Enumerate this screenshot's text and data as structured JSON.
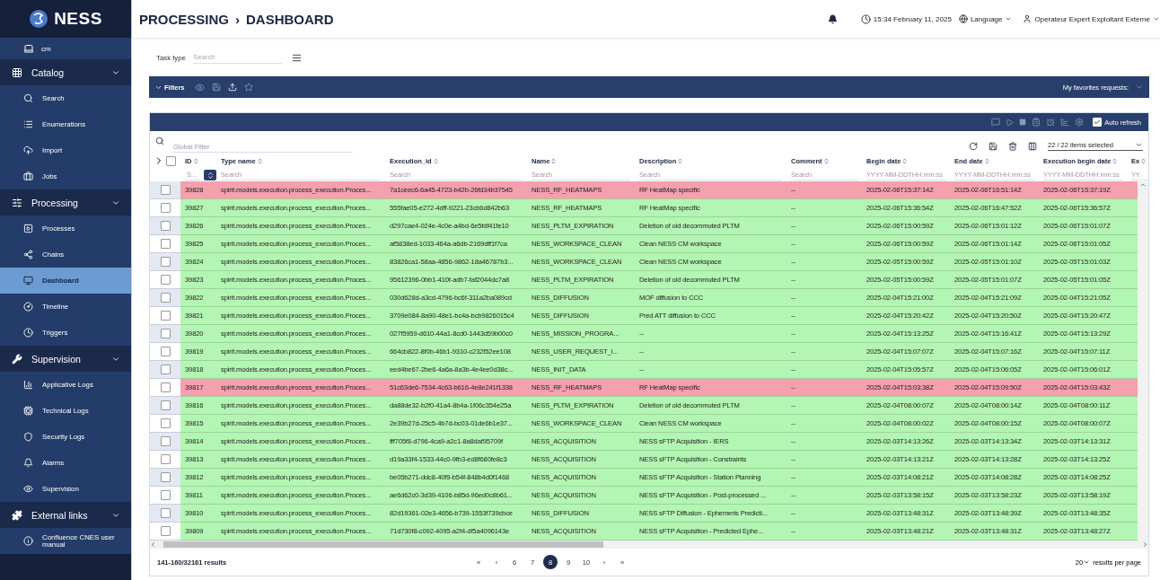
{
  "logo": {
    "text": "NESS"
  },
  "sidebar": {
    "top_item": {
      "label": "cm",
      "selected": false
    },
    "groups": [
      {
        "label": "Catalog",
        "expanded": true,
        "children": [
          {
            "label": "Search",
            "selected": false
          },
          {
            "label": "Enumerations",
            "selected": false
          },
          {
            "label": "Import",
            "selected": false
          },
          {
            "label": "Jobs",
            "selected": false
          }
        ]
      },
      {
        "label": "Processing",
        "expanded": true,
        "children": [
          {
            "label": "Processes",
            "selected": false
          },
          {
            "label": "Chains",
            "selected": false
          },
          {
            "label": "Dashboard",
            "selected": true
          },
          {
            "label": "Timeline",
            "selected": false
          },
          {
            "label": "Triggers",
            "selected": false
          }
        ]
      },
      {
        "label": "Supervision",
        "expanded": true,
        "children": [
          {
            "label": "Applicative Logs",
            "selected": false
          },
          {
            "label": "Technical Logs",
            "selected": false
          },
          {
            "label": "Security Logs",
            "selected": false
          },
          {
            "label": "Alarms",
            "selected": false
          },
          {
            "label": "Supervision",
            "selected": false
          }
        ]
      },
      {
        "label": "External links",
        "expanded": true,
        "children": [
          {
            "label": "Confluence CNES user manual",
            "selected": false
          }
        ]
      }
    ]
  },
  "header": {
    "breadcrumb": [
      "PROCESSING",
      "›",
      "DASHBOARD"
    ],
    "time": "15:34 February 11, 2025",
    "language": "Language",
    "user": "Operateur Expert Exploitant Externe"
  },
  "task_type": {
    "label": "Task type",
    "placeholder": "Search"
  },
  "filters_bar": {
    "label": "Filters",
    "expanded": true,
    "favorites_label": "My favorites requests:"
  },
  "table": {
    "auto_refresh": {
      "label": "Auto refresh",
      "checked": true
    },
    "global_filter": {
      "placeholder": "Global Filter"
    },
    "columns_selected": "22 / 22 items selected",
    "header_checked": false,
    "columns": [
      {
        "label": "ID",
        "placeholder": "S..."
      },
      {
        "label": "Type name",
        "placeholder": "Search"
      },
      {
        "label": "Execution_id",
        "placeholder": "Search"
      },
      {
        "label": "Name",
        "placeholder": "Search"
      },
      {
        "label": "Description",
        "placeholder": "Search"
      },
      {
        "label": "Comment",
        "placeholder": "Search"
      },
      {
        "label": "Begin date",
        "placeholder": "YYYY-MM-DDTHH:mm:ss"
      },
      {
        "label": "End date",
        "placeholder": "YYYY-MM-DDTHH:mm:ss"
      },
      {
        "label": "Execution begin date",
        "placeholder": "YYYY-MM-DDTHH:mm:ss"
      },
      {
        "label": "Ex",
        "placeholder": "YY"
      }
    ],
    "rows": [
      {
        "color": "#f4a0ad",
        "checked": false,
        "cells": [
          "39828",
          "spirit.models.execution.process_execution.Proces...",
          "7a1ceec6-6a45-4723-b42b-26fd34b37545",
          "NESS_RF_HEATMAPS",
          "RF HeatMap specific",
          "--",
          "2025-02-06T15:37:14Z",
          "2025-02-06T16:51:14Z",
          "2025-02-06T15:37:19Z"
        ]
      },
      {
        "color": "#b3f5b3",
        "checked": false,
        "cells": [
          "39827",
          "spirit.models.execution.process_execution.Proces...",
          "555fae05-e272-4dff-9221-23cb6d842b63",
          "NESS_RF_HEATMAPS",
          "RF HeatMap specific",
          "--",
          "2025-02-06T15:36:54Z",
          "2025-02-06T16:47:52Z",
          "2025-02-06T15:36:57Z"
        ]
      },
      {
        "color": "#b3f5b3",
        "checked": false,
        "cells": [
          "39826",
          "spirit.models.execution.process_execution.Proces...",
          "d297cae4-024e-4c0e-a4bd-6e5fdf41fe10",
          "NESS_PLTM_EXPIRATION",
          "Deletion of old decommuted PLTM",
          "--",
          "2025-02-06T15:00:59Z",
          "2025-02-06T15:01:12Z",
          "2025-02-06T15:01:07Z"
        ]
      },
      {
        "color": "#b3f5b3",
        "checked": false,
        "cells": [
          "39825",
          "spirit.models.execution.process_execution.Proces...",
          "af5838ed-1033-464a-a6db-2169dff1f7ca",
          "NESS_WORKSPACE_CLEAN",
          "Clean NESS CM workspace",
          "--",
          "2025-02-06T15:00:59Z",
          "2025-02-06T15:01:14Z",
          "2025-02-06T15:01:05Z"
        ]
      },
      {
        "color": "#b3f5b3",
        "checked": false,
        "cells": [
          "39824",
          "spirit.models.execution.process_execution.Proces...",
          "83826ca1-58aa-4856-9862-18a46787b3...",
          "NESS_WORKSPACE_CLEAN",
          "Clean NESS CM workspace",
          "--",
          "2025-02-05T15:00:59Z",
          "2025-02-05T15:01:10Z",
          "2025-02-05T15:01:03Z"
        ]
      },
      {
        "color": "#b3f5b3",
        "checked": false,
        "cells": [
          "39823",
          "spirit.models.execution.process_execution.Proces...",
          "95612396-0bb1-410f-adb7-faf2044dc7a8",
          "NESS_PLTM_EXPIRATION",
          "Deletion of old decommuted PLTM",
          "--",
          "2025-02-05T15:00:59Z",
          "2025-02-05T15:01:07Z",
          "2025-02-05T15:01:05Z"
        ]
      },
      {
        "color": "#b3f5b3",
        "checked": false,
        "cells": [
          "39822",
          "spirit.models.execution.process_execution.Proces...",
          "030d628d-a3cd-4796-bc6f-311a2ba089cd",
          "NESS_DIFFUSION",
          "MOF diffusion to CCC",
          "--",
          "2025-02-04T15:21:00Z",
          "2025-02-04T15:21:09Z",
          "2025-02-04T15:21:05Z"
        ]
      },
      {
        "color": "#b3f5b3",
        "checked": false,
        "cells": [
          "39821",
          "spirit.models.execution.process_execution.Proces...",
          "3709e084-8a90-48e1-bc4a-bcb9826015c4",
          "NESS_DIFFUSION",
          "Pred ATT diffusion to CCC",
          "--",
          "2025-02-04T15:20:42Z",
          "2025-02-04T15:20:50Z",
          "2025-02-04T15:20:47Z"
        ]
      },
      {
        "color": "#b3f5b3",
        "checked": false,
        "cells": [
          "39820",
          "spirit.models.execution.process_execution.Proces...",
          "027f5959-d610-44a1-8cd0-1443d59b00c0",
          "NESS_MISSION_PROGRA...",
          "--",
          "--",
          "2025-02-04T15:13:25Z",
          "2025-02-04T15:16:41Z",
          "2025-02-04T15:13:29Z"
        ]
      },
      {
        "color": "#b3f5b3",
        "checked": false,
        "cells": [
          "39819",
          "spirit.models.execution.process_execution.Proces...",
          "664cb822-8f0b-46b1-9310-c232f52ee108",
          "NESS_USER_REQUEST_I...",
          "--",
          "--",
          "2025-02-04T15:07:07Z",
          "2025-02-04T15:07:16Z",
          "2025-02-04T15:07:11Z"
        ]
      },
      {
        "color": "#b3f5b3",
        "checked": false,
        "cells": [
          "39818",
          "spirit.models.execution.process_execution.Proces...",
          "eed4be67-2be6-4a6a-8a3b-4e4ee0d38c...",
          "NESS_INIT_DATA",
          "--",
          "--",
          "2025-02-04T15:05:57Z",
          "2025-02-04T15:06:05Z",
          "2025-02-04T15:06:01Z"
        ]
      },
      {
        "color": "#f4a0ad",
        "checked": false,
        "cells": [
          "39817",
          "spirit.models.execution.process_execution.Proces...",
          "51c63de6-7534-4c63-b616-4e8e241f1338",
          "NESS_RF_HEATMAPS",
          "RF HeatMap specific",
          "--",
          "2025-02-04T15:03:38Z",
          "2025-02-04T15:09:50Z",
          "2025-02-04T15:03:43Z"
        ]
      },
      {
        "color": "#b3f5b3",
        "checked": false,
        "cells": [
          "39816",
          "spirit.models.execution.process_execution.Proces...",
          "da88de32-b2f0-41a4-8b4a-1f06c354e25a",
          "NESS_PLTM_EXPIRATION",
          "Deletion of old decommuted PLTM",
          "--",
          "2025-02-04T08:00:07Z",
          "2025-02-04T08:00:14Z",
          "2025-02-04T08:00:11Z"
        ]
      },
      {
        "color": "#b3f5b3",
        "checked": false,
        "cells": [
          "39815",
          "spirit.models.execution.process_execution.Proces...",
          "2e39b27d-25c5-4b7d-bc03-01de6b1e37...",
          "NESS_WORKSPACE_CLEAN",
          "Clean NESS CM workspace",
          "--",
          "2025-02-04T08:00:02Z",
          "2025-02-04T08:00:15Z",
          "2025-02-04T08:00:07Z"
        ]
      },
      {
        "color": "#b3f5b3",
        "checked": false,
        "cells": [
          "39814",
          "spirit.models.execution.process_execution.Proces...",
          "fff705f8-d796-4ca9-a2c1-8a8daf95709f",
          "NESS_ACQUISITION",
          "NESS sFTP Acquisition - IERS",
          "--",
          "2025-02-03T14:13:26Z",
          "2025-02-03T14:13:34Z",
          "2025-02-03T14:13:31Z"
        ]
      },
      {
        "color": "#b3f5b3",
        "checked": false,
        "cells": [
          "39813",
          "spirit.models.execution.process_execution.Proces...",
          "d19a33f4-1533-44c0-9fb3-ed8f680fe8c3",
          "NESS_ACQUISITION",
          "NESS sFTP Acquisition - Constraints",
          "--",
          "2025-02-03T14:13:21Z",
          "2025-02-03T14:13:28Z",
          "2025-02-03T14:13:25Z"
        ]
      },
      {
        "color": "#b3f5b3",
        "checked": false,
        "cells": [
          "39812",
          "spirit.models.execution.process_execution.Proces...",
          "be05b271-ddc8-40f9-b54f-848b4d0f1468",
          "NESS_ACQUISITION",
          "NESS sFTP Acquisition - Station Planning",
          "--",
          "2025-02-03T14:08:21Z",
          "2025-02-03T14:08:28Z",
          "2025-02-03T14:08:25Z"
        ]
      },
      {
        "color": "#b3f5b3",
        "checked": false,
        "cells": [
          "39811",
          "spirit.models.execution.process_execution.Proces...",
          "ae6d62c0-3d39-4106-b85d-96ed0c8b61...",
          "NESS_ACQUISITION",
          "NESS sFTP Acquisition - Post-processed ...",
          "--",
          "2025-02-03T13:58:15Z",
          "2025-02-03T13:58:23Z",
          "2025-02-03T13:58:19Z"
        ]
      },
      {
        "color": "#b3f5b3",
        "checked": false,
        "cells": [
          "39810",
          "spirit.models.execution.process_execution.Proces...",
          "82d19361-02e3-4656-b739-1553f739cbce",
          "NESS_DIFFUSION",
          "NESS sFTP Diffusion - Ephemeris Predicti...",
          "--",
          "2025-02-03T13:48:31Z",
          "2025-02-03T13:48:39Z",
          "2025-02-03T13:48:35Z"
        ]
      },
      {
        "color": "#b3f5b3",
        "checked": false,
        "cells": [
          "39809",
          "spirit.models.execution.process_execution.Proces...",
          "71d730f8-c092-4095-a2f4-df5a4096143e",
          "NESS_ACQUISITION",
          "NESS sFTP Acquisition - Predicted Ephe...",
          "--",
          "2025-02-03T13:48:21Z",
          "2025-02-03T13:48:31Z",
          "2025-02-03T13:48:27Z"
        ]
      }
    ]
  },
  "footer": {
    "results": "141-160/32161 results",
    "pages": [
      {
        "label": "«",
        "selected": false
      },
      {
        "label": "‹",
        "selected": false
      },
      {
        "label": "6",
        "selected": false
      },
      {
        "label": "7",
        "selected": false
      },
      {
        "label": "8",
        "selected": true
      },
      {
        "label": "9",
        "selected": false
      },
      {
        "label": "10",
        "selected": false
      },
      {
        "label": "›",
        "selected": false
      },
      {
        "label": "»",
        "selected": false
      }
    ],
    "per_page": "20",
    "per_page_label": "results per page"
  }
}
